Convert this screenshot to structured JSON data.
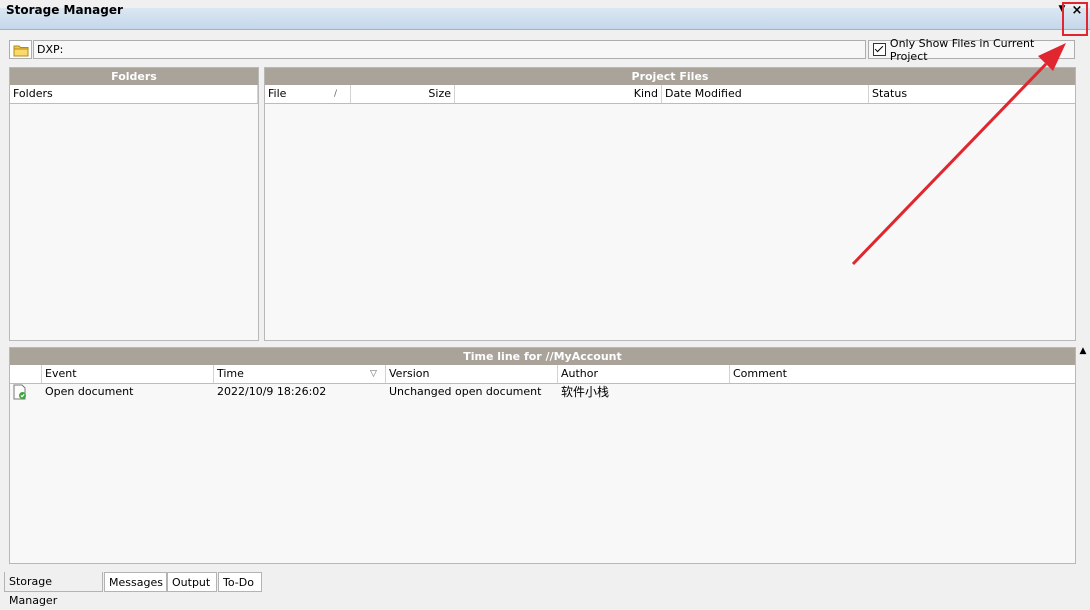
{
  "window": {
    "title": "Storage Manager",
    "menu_glyph": "▼",
    "close_glyph": "×"
  },
  "path_bar": {
    "path": "DXP:",
    "only_show_label": "Only Show Files in Current Project",
    "only_show_checked": true
  },
  "folders_panel": {
    "title": "Folders",
    "columns": [
      "Folders"
    ]
  },
  "project_files_panel": {
    "title": "Project Files",
    "columns": [
      "File",
      "Size",
      "Kind",
      "Date Modified",
      "Status"
    ]
  },
  "timeline_panel": {
    "title": "Time line for //MyAccount",
    "columns": [
      "Event",
      "Time",
      "Version",
      "Author",
      "Comment"
    ],
    "rows": [
      {
        "event": "Open document",
        "time": "2022/10/9 18:26:02",
        "version": "Unchanged open document",
        "author": "软件小栈",
        "comment": ""
      }
    ]
  },
  "tabs": [
    {
      "label": "Storage Manager",
      "active": true
    },
    {
      "label": "Messages",
      "active": false
    },
    {
      "label": "Output",
      "active": false
    },
    {
      "label": "To-Do",
      "active": false
    }
  ],
  "annotation": {
    "arrow_color": "#e0262e"
  }
}
